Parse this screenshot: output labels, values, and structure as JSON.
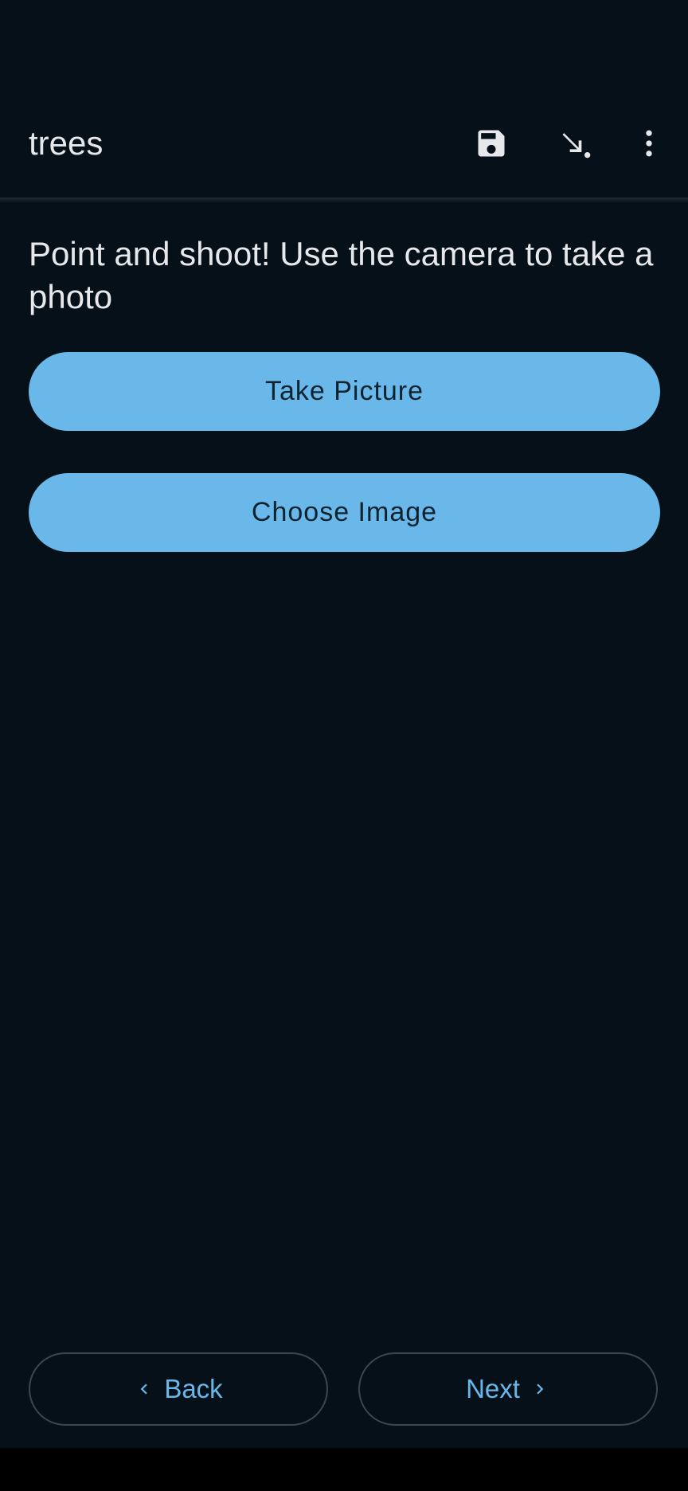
{
  "app_bar": {
    "title": "trees",
    "icons": [
      "save-icon",
      "download-arrow-icon",
      "more-vert-icon"
    ]
  },
  "main": {
    "prompt": "Point and shoot! Use the camera to take a photo",
    "take_picture_label": "Take Picture",
    "choose_image_label": "Choose Image"
  },
  "footer": {
    "back_label": "Back",
    "next_label": "Next"
  },
  "colors": {
    "background": "#061018",
    "accent": "#6ab8ea",
    "text": "#e6e8eb",
    "button_text": "#0d2330"
  }
}
